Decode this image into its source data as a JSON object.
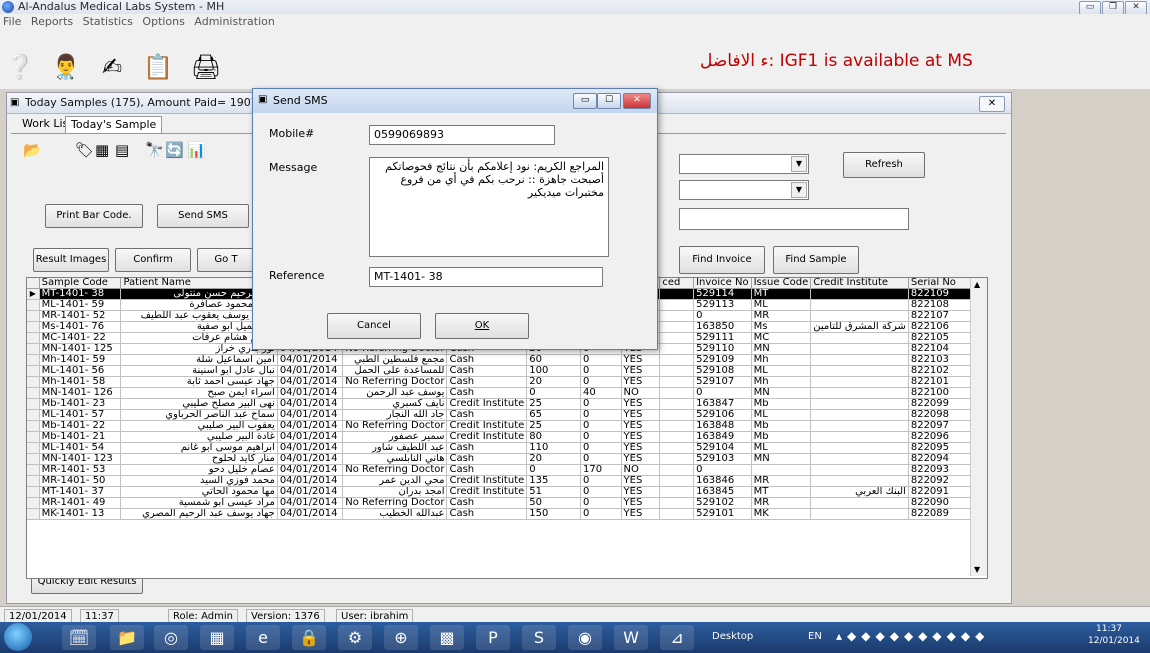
{
  "app": {
    "title": "Al-Andalus Medical Labs System - MH"
  },
  "menu": [
    "File",
    "Reports",
    "Statistics",
    "Options",
    "Administration"
  ],
  "announcement": "ء الافاضل: IGF1 is available at MS",
  "child": {
    "title": "Today Samples (175), Amount Paid= 1907.5, Pay",
    "close": "✕",
    "tabs": [
      "Work List",
      "Today's Sample"
    ],
    "buttons": {
      "print_barcode": "Print Bar Code.",
      "send_sms": "Send SMS",
      "result_images": "Result Images",
      "confirm": "Confirm",
      "goto": "Go T",
      "refresh": "Refresh",
      "find_invoice": "Find Invoice",
      "find_sample": "Find Sample",
      "quick_edit": "Quickly Edit Results"
    }
  },
  "grid": {
    "headers": [
      "Sample Code",
      "Patient Name",
      "",
      "",
      "",
      "",
      "",
      "",
      "ced",
      "Invoice No",
      "Issue Code",
      "Credit Institute",
      "Serial No"
    ],
    "rows": [
      {
        "code": "MT-1401- 38",
        "name": "عبد الرحيم حسن منتولى",
        "date": "",
        "doctor": "",
        "pay": "",
        "amt": "",
        "disc": "",
        "conf": "",
        "inv": "529114",
        "issue": "MT",
        "credit": "",
        "serial": "822109",
        "sel": true
      },
      {
        "code": "ML-1401- 59",
        "name": "زهير محمود عصافرة",
        "date": "",
        "doctor": "",
        "pay": "",
        "amt": "",
        "disc": "",
        "conf": "",
        "inv": "529113",
        "issue": "ML",
        "credit": "",
        "serial": "822108"
      },
      {
        "code": "MR-1401- 52",
        "name": "جميل يوسف يعقوب عبد اللطيف",
        "date": "",
        "doctor": "",
        "pay": "",
        "amt": "",
        "disc": "",
        "conf": "",
        "inv": "0",
        "issue": "MR",
        "credit": "",
        "serial": "822107"
      },
      {
        "code": "Ms-1401- 76",
        "name": "الاء جميل ابو صفية",
        "date": "",
        "doctor": "",
        "pay": "",
        "amt": "",
        "disc": "",
        "conf": "",
        "inv": "163850",
        "issue": "Ms",
        "credit": "شركة المشرق للتامين",
        "serial": "822106"
      },
      {
        "code": "MC-1401- 22",
        "name": "عاصم هشام عرفات",
        "date": "",
        "doctor": "",
        "pay": "",
        "amt": "",
        "disc": "",
        "conf": "",
        "inv": "529111",
        "issue": "MC",
        "credit": "",
        "serial": "822105"
      },
      {
        "code": "MN-1401- 125",
        "name": "نور بدري خراز",
        "date": "04/01/2014",
        "doctor": "No Referring Doctor",
        "pay": "Cash",
        "amt": "20",
        "disc": "0",
        "conf": "YES",
        "inv": "529110",
        "issue": "MN",
        "credit": "",
        "serial": "822104"
      },
      {
        "code": "Mh-1401- 59",
        "name": "امين اسماعيل شلة",
        "date": "04/01/2014",
        "doctor": "مجمع فلسطين الطبي",
        "pay": "Cash",
        "amt": "60",
        "disc": "0",
        "conf": "YES",
        "inv": "529109",
        "issue": "Mh",
        "credit": "",
        "serial": "822103"
      },
      {
        "code": "ML-1401- 56",
        "name": "نبال عادل ابو اسنينة",
        "date": "04/01/2014",
        "doctor": "للمساعدة على الحمل",
        "pay": "Cash",
        "amt": "100",
        "disc": "0",
        "conf": "YES",
        "inv": "529108",
        "issue": "ML",
        "credit": "",
        "serial": "822102"
      },
      {
        "code": "Mh-1401- 58",
        "name": "جهاد عيسى احمد ثابة",
        "date": "04/01/2014",
        "doctor": "No Referring Doctor",
        "pay": "Cash",
        "amt": "20",
        "disc": "0",
        "conf": "YES",
        "inv": "529107",
        "issue": "Mh",
        "credit": "",
        "serial": "822101"
      },
      {
        "code": "MN-1401- 126",
        "name": "اسراء ايمن صبح",
        "date": "04/01/2014",
        "doctor": "يوسف عبد الرحمن",
        "pay": "Cash",
        "amt": "0",
        "disc": "40",
        "conf": "NO",
        "inv": "0",
        "issue": "MN",
        "credit": "",
        "serial": "822100"
      },
      {
        "code": "Mb-1401- 23",
        "name": "نهى البير مصلح صليبي",
        "date": "04/01/2014",
        "doctor": "نايف كسبري",
        "pay": "Credit Institute",
        "amt": "25",
        "disc": "0",
        "conf": "YES",
        "inv": "163847",
        "issue": "Mb",
        "credit": "",
        "serial": "822099"
      },
      {
        "code": "ML-1401- 57",
        "name": "سماح عبد الناصر الحرباوي",
        "date": "04/01/2014",
        "doctor": "جاد الله النجار",
        "pay": "Cash",
        "amt": "65",
        "disc": "0",
        "conf": "YES",
        "inv": "529106",
        "issue": "ML",
        "credit": "",
        "serial": "822098"
      },
      {
        "code": "Mb-1401- 22",
        "name": "يعقوب البير صليبي",
        "date": "04/01/2014",
        "doctor": "No Referring Doctor",
        "pay": "Credit Institute",
        "amt": "25",
        "disc": "0",
        "conf": "YES",
        "inv": "163848",
        "issue": "Mb",
        "credit": "",
        "serial": "822097"
      },
      {
        "code": "Mb-1401- 21",
        "name": "غادة البير صليبي",
        "date": "04/01/2014",
        "doctor": "سمير عصفور",
        "pay": "Credit Institute",
        "amt": "80",
        "disc": "0",
        "conf": "YES",
        "inv": "163849",
        "issue": "Mb",
        "credit": "",
        "serial": "822096"
      },
      {
        "code": "ML-1401- 54",
        "name": "ابراهيم موسى ابو غانم",
        "date": "04/01/2014",
        "doctor": "عبد اللطيف شاور",
        "pay": "Cash",
        "amt": "110",
        "disc": "0",
        "conf": "YES",
        "inv": "529104",
        "issue": "ML",
        "credit": "",
        "serial": "822095"
      },
      {
        "code": "MN-1401- 123",
        "name": "منار كايد لحلوح",
        "date": "04/01/2014",
        "doctor": "هاني النابلسي",
        "pay": "Cash",
        "amt": "20",
        "disc": "0",
        "conf": "YES",
        "inv": "529103",
        "issue": "MN",
        "credit": "",
        "serial": "822094"
      },
      {
        "code": "MR-1401- 53",
        "name": "عصام خليل دحو",
        "date": "04/01/2014",
        "doctor": "No Referring Doctor",
        "pay": "Cash",
        "amt": "0",
        "disc": "170",
        "conf": "NO",
        "inv": "0",
        "issue": "",
        "credit": "",
        "serial": "822093"
      },
      {
        "code": "MR-1401- 50",
        "name": "محمد فوزي السيد",
        "date": "04/01/2014",
        "doctor": "محي الدين عمر",
        "pay": "Credit Institute",
        "amt": "135",
        "disc": "0",
        "conf": "YES",
        "inv": "163846",
        "issue": "MR",
        "credit": "",
        "serial": "822092"
      },
      {
        "code": "MT-1401- 37",
        "name": "مها محمود الحاتي",
        "date": "04/01/2014",
        "doctor": "امجد بدران",
        "pay": "Credit Institute",
        "amt": "51",
        "disc": "0",
        "conf": "YES",
        "inv": "163845",
        "issue": "MT",
        "credit": "البنك العربي",
        "serial": "822091"
      },
      {
        "code": "MR-1401- 49",
        "name": "مراد عيسى ابو شمسية",
        "date": "04/01/2014",
        "doctor": "No Referring Doctor",
        "pay": "Cash",
        "amt": "50",
        "disc": "0",
        "conf": "YES",
        "inv": "529102",
        "issue": "MR",
        "credit": "",
        "serial": "822090"
      },
      {
        "code": "MK-1401- 13",
        "name": "جهاد يوسف عبد الرحيم المصري",
        "date": "04/01/2014",
        "doctor": "عبدالله الخطيب",
        "pay": "Cash",
        "amt": "150",
        "disc": "0",
        "conf": "YES",
        "inv": "529101",
        "issue": "MK",
        "credit": "",
        "serial": "822089"
      }
    ]
  },
  "sms": {
    "title": "Send SMS",
    "mobile_label": "Mobile#",
    "mobile_value": "0599069893",
    "message_label": "Message",
    "message_value": "المراجع الكريم: نود إعلامكم بأن نتائج فحوصاتكم أصبحت جاهزة :: نرحب بكم في أي من فروع مختبرات ميديكير",
    "reference_label": "Reference",
    "reference_value": "MT-1401- 38",
    "cancel": "Cancel",
    "ok": "OK"
  },
  "status": {
    "date": "12/01/2014",
    "time": "11:37",
    "role": "Role: Admin",
    "version": "Version: 1376",
    "user": "User: ibrahim"
  },
  "taskbar": {
    "desktop": "Desktop",
    "lang": "EN",
    "clock_time": "11:37",
    "clock_date": "12/01/2014"
  }
}
